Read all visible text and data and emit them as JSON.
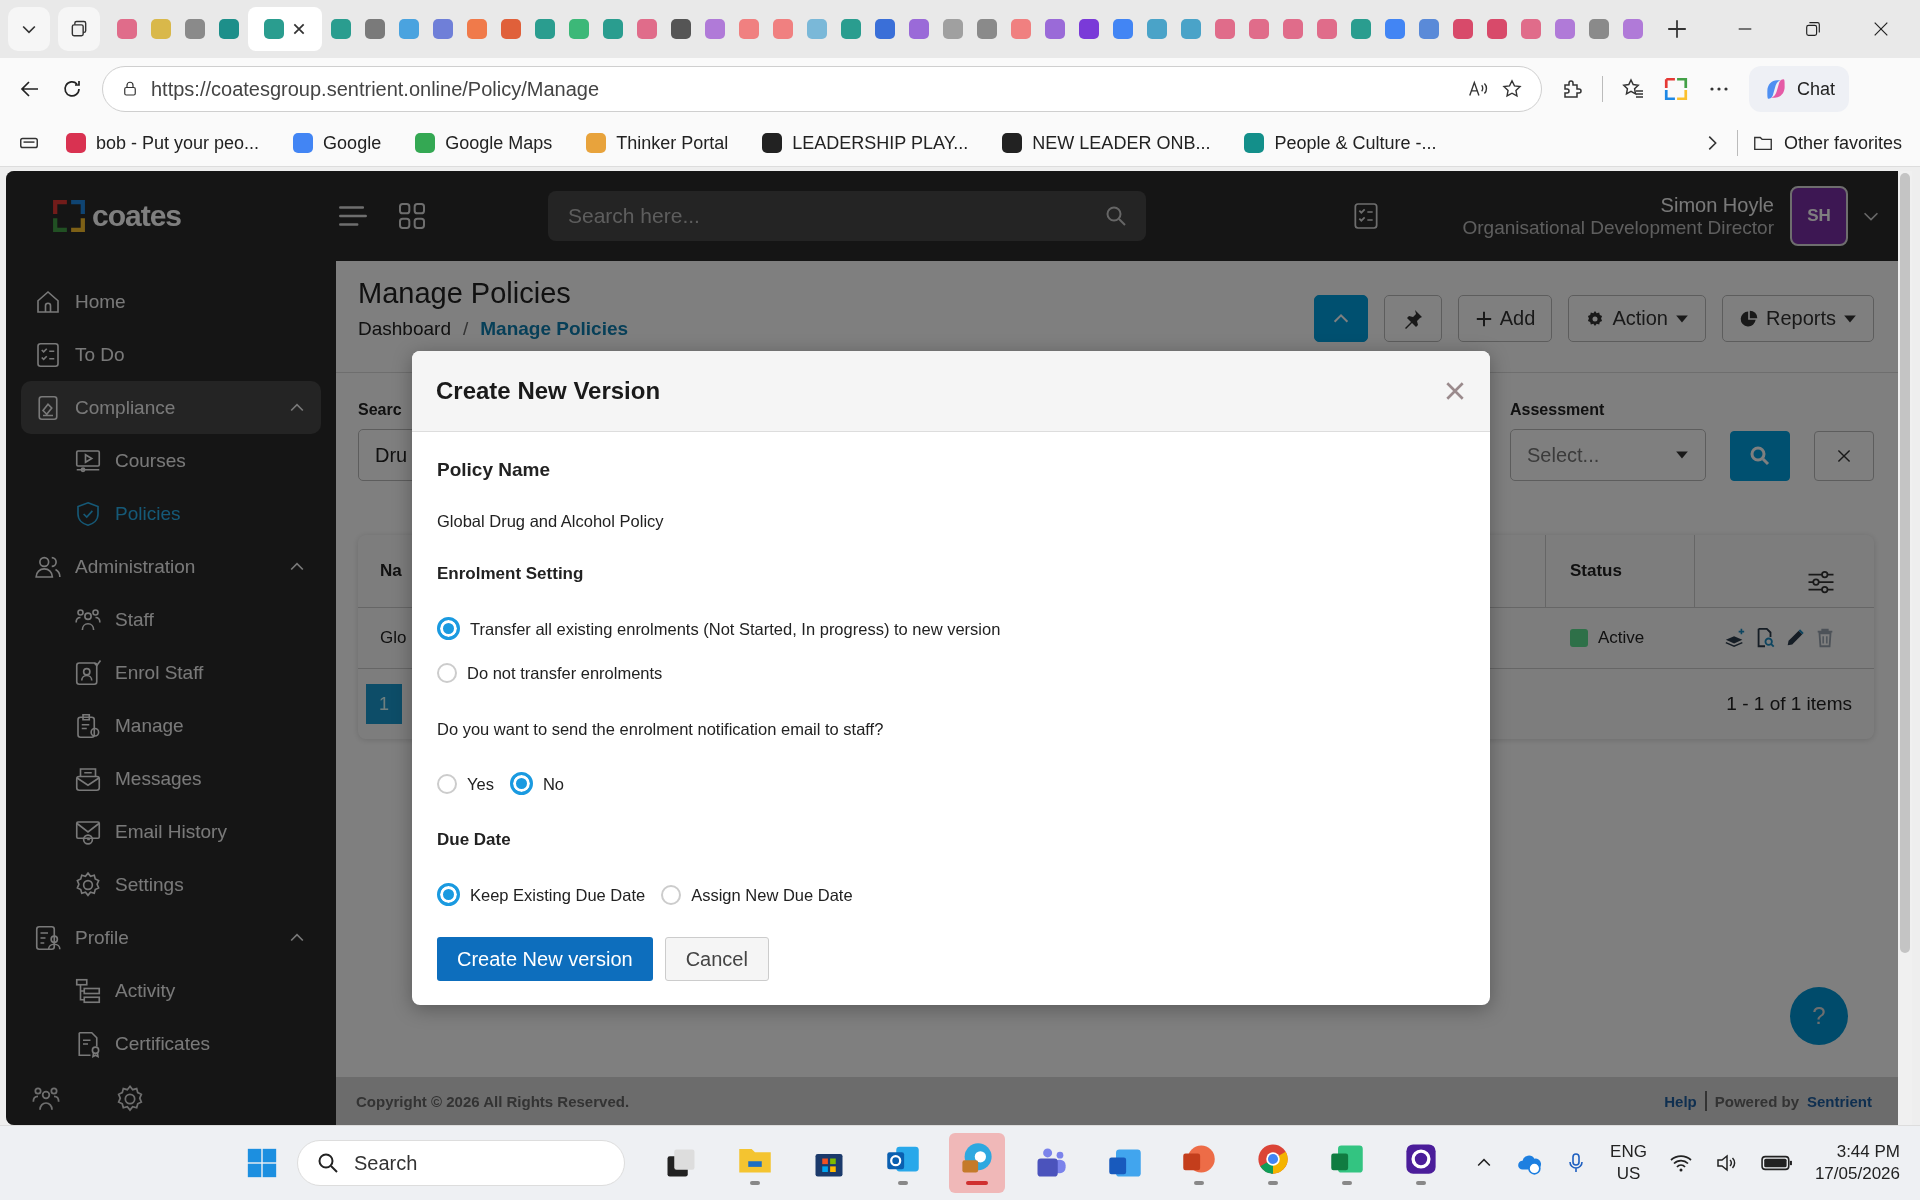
{
  "browser": {
    "tabs": [
      {
        "color": "#e06c8a",
        "selected": false
      },
      {
        "color": "#d9b84a",
        "selected": false
      },
      {
        "color": "#8a8a8a",
        "selected": false
      },
      {
        "color": "#1d8f8a",
        "selected": false
      },
      {
        "color": "#2a9d8f",
        "selected": true
      },
      {
        "color": "#2a9d8f",
        "selected": false
      },
      {
        "color": "#7a7a7a",
        "selected": false
      },
      {
        "color": "#4aa3df",
        "selected": false
      },
      {
        "color": "#6f7fd8",
        "selected": false
      },
      {
        "color": "#f07a4a",
        "selected": false
      },
      {
        "color": "#e0603a",
        "selected": false
      },
      {
        "color": "#2a9d8f",
        "selected": false
      },
      {
        "color": "#3cb878",
        "selected": false
      },
      {
        "color": "#2a9d8f",
        "selected": false
      },
      {
        "color": "#e06c8a",
        "selected": false
      },
      {
        "color": "#555555",
        "selected": false
      },
      {
        "color": "#b07ad8",
        "selected": false
      },
      {
        "color": "#f08080",
        "selected": false
      },
      {
        "color": "#f08080",
        "selected": false
      },
      {
        "color": "#7ab8d8",
        "selected": false
      },
      {
        "color": "#2a9d8f",
        "selected": false
      },
      {
        "color": "#3a6fd8",
        "selected": false
      },
      {
        "color": "#9a6ad8",
        "selected": false
      },
      {
        "color": "#a0a0a0",
        "selected": false
      },
      {
        "color": "#8a8a8a",
        "selected": false
      },
      {
        "color": "#f08080",
        "selected": false
      },
      {
        "color": "#9a6ad8",
        "selected": false
      },
      {
        "color": "#7a3ad8",
        "selected": false
      },
      {
        "color": "#4285f4",
        "selected": false
      },
      {
        "color": "#4aa3c8",
        "selected": false
      },
      {
        "color": "#4aa3c8",
        "selected": false
      },
      {
        "color": "#e06c8a",
        "selected": false
      },
      {
        "color": "#e06c8a",
        "selected": false
      },
      {
        "color": "#e06c8a",
        "selected": false
      },
      {
        "color": "#e06c8a",
        "selected": false
      },
      {
        "color": "#2a9d8f",
        "selected": false
      },
      {
        "color": "#4285f4",
        "selected": false
      },
      {
        "color": "#5a8ad8",
        "selected": false
      },
      {
        "color": "#d84a6a",
        "selected": false
      },
      {
        "color": "#d84a6a",
        "selected": false
      },
      {
        "color": "#e06c8a",
        "selected": false
      },
      {
        "color": "#b07ad8",
        "selected": false
      },
      {
        "color": "#8a8a8a",
        "selected": false
      },
      {
        "color": "#b07ad8",
        "selected": false
      }
    ],
    "url": "https://coatesgroup.sentrient.online/Policy/Manage",
    "chat": "Chat",
    "bookmarks": [
      {
        "label": "bob - Put your peo...",
        "color": "#d93251"
      },
      {
        "label": "Google",
        "color": "#4285f4"
      },
      {
        "label": "Google Maps",
        "color": "#34a853"
      },
      {
        "label": "Thinker Portal",
        "color": "#e8a33c"
      },
      {
        "label": "LEADERSHIP PLAY...",
        "color": "#222222"
      },
      {
        "label": "NEW LEADER ONB...",
        "color": "#222222"
      },
      {
        "label": "People & Culture -...",
        "color": "#138f8a"
      }
    ],
    "other_favorites": "Other favorites"
  },
  "app": {
    "logo": "coates",
    "search_placeholder": "Search here...",
    "user": {
      "name": "Simon Hoyle",
      "role": "Organisational Development Director",
      "initials": "SH"
    }
  },
  "sidebar": {
    "items": [
      {
        "label": "Home",
        "kind": "home",
        "selected": false
      },
      {
        "label": "To Do",
        "kind": "todo",
        "selected": false
      },
      {
        "label": "Compliance",
        "kind": "compliance",
        "selected": true,
        "expanded": true,
        "children": [
          {
            "label": "Courses",
            "kind": "courses",
            "selected": false
          },
          {
            "label": "Policies",
            "kind": "policies",
            "selected": true
          }
        ]
      },
      {
        "label": "Administration",
        "kind": "admin",
        "selected": false,
        "expanded": true,
        "children": [
          {
            "label": "Staff",
            "kind": "staff",
            "selected": false
          },
          {
            "label": "Enrol Staff",
            "kind": "enrol",
            "selected": false
          },
          {
            "label": "Manage",
            "kind": "manage",
            "selected": false
          },
          {
            "label": "Messages",
            "kind": "messages",
            "selected": false
          },
          {
            "label": "Email History",
            "kind": "email",
            "selected": false
          },
          {
            "label": "Settings",
            "kind": "settings",
            "selected": false
          }
        ]
      },
      {
        "label": "Profile",
        "kind": "profile",
        "selected": false,
        "expanded": true,
        "children": [
          {
            "label": "Activity",
            "kind": "activity",
            "selected": false
          },
          {
            "label": "Certificates",
            "kind": "certificates",
            "selected": false
          }
        ]
      }
    ]
  },
  "page": {
    "title": "Manage Policies",
    "breadcrumb": [
      {
        "label": "Dashboard",
        "selected": false
      },
      {
        "label": "Manage Policies",
        "selected": true
      }
    ],
    "breadcrumb_separator": "/",
    "toolbar": [
      {
        "kind": "collapse"
      },
      {
        "kind": "pin"
      },
      {
        "kind": "add",
        "label": "Add"
      },
      {
        "kind": "action",
        "label": "Action"
      },
      {
        "kind": "reports",
        "label": "Reports"
      }
    ],
    "filters": {
      "search_label": "Searc",
      "search_value": "Dru",
      "assessment_label": "Assessment",
      "assessment_placeholder": "Select..."
    },
    "table": {
      "columns": [
        "Na",
        "Status"
      ],
      "rows": [
        {
          "name": "Glo",
          "status": "Active",
          "color": "#2e7048"
        }
      ]
    },
    "pagination": {
      "pages": [
        {
          "label": "1",
          "selected": true
        }
      ],
      "summary": "1 - 1 of 1 items"
    },
    "help": "?",
    "footer": {
      "copyright": "Copyright © 2026 All Rights Reserved.",
      "help": "Help",
      "powered_by": "Powered by",
      "brand": "Sentrient"
    }
  },
  "modal": {
    "title": "Create New Version",
    "policy_label": "Policy Name",
    "policy_name": "Global Drug and Alcohol Policy",
    "groups": [
      {
        "heading": "Enrolment Setting",
        "options": [
          {
            "label": "Transfer all existing enrolments (Not Started, In progress) to new version",
            "selected": true
          },
          {
            "label": "Do not transfer enrolments",
            "selected": false
          }
        ]
      },
      {
        "heading": "Do you want to send the enrolment notification email to staff?",
        "options": [
          {
            "label": "Yes",
            "selected": false
          },
          {
            "label": "No",
            "selected": true
          }
        ]
      },
      {
        "heading": "Due Date",
        "options": [
          {
            "label": "Keep Existing Due Date",
            "selected": true
          },
          {
            "label": "Assign New Due Date",
            "selected": false
          }
        ]
      }
    ],
    "primary": "Create New version",
    "cancel": "Cancel"
  },
  "taskbar": {
    "search_placeholder": "Search",
    "apps": [
      {
        "kind": "taskview",
        "running": false,
        "selected": false
      },
      {
        "kind": "folder",
        "running": true,
        "selected": false
      },
      {
        "kind": "store",
        "running": false,
        "selected": false
      },
      {
        "kind": "mail",
        "running": true,
        "selected": false
      },
      {
        "kind": "browser",
        "running": true,
        "selected": true
      },
      {
        "kind": "teams",
        "running": false,
        "selected": false
      },
      {
        "kind": "word",
        "running": false,
        "selected": false
      },
      {
        "kind": "slides",
        "running": true,
        "selected": false
      },
      {
        "kind": "chrome",
        "running": true,
        "selected": false
      },
      {
        "kind": "sheet",
        "running": true,
        "selected": false
      },
      {
        "kind": "purple",
        "running": true,
        "selected": false
      }
    ],
    "lang": "ENG",
    "region": "US",
    "time": "3:44 PM",
    "date": "17/05/2026"
  }
}
